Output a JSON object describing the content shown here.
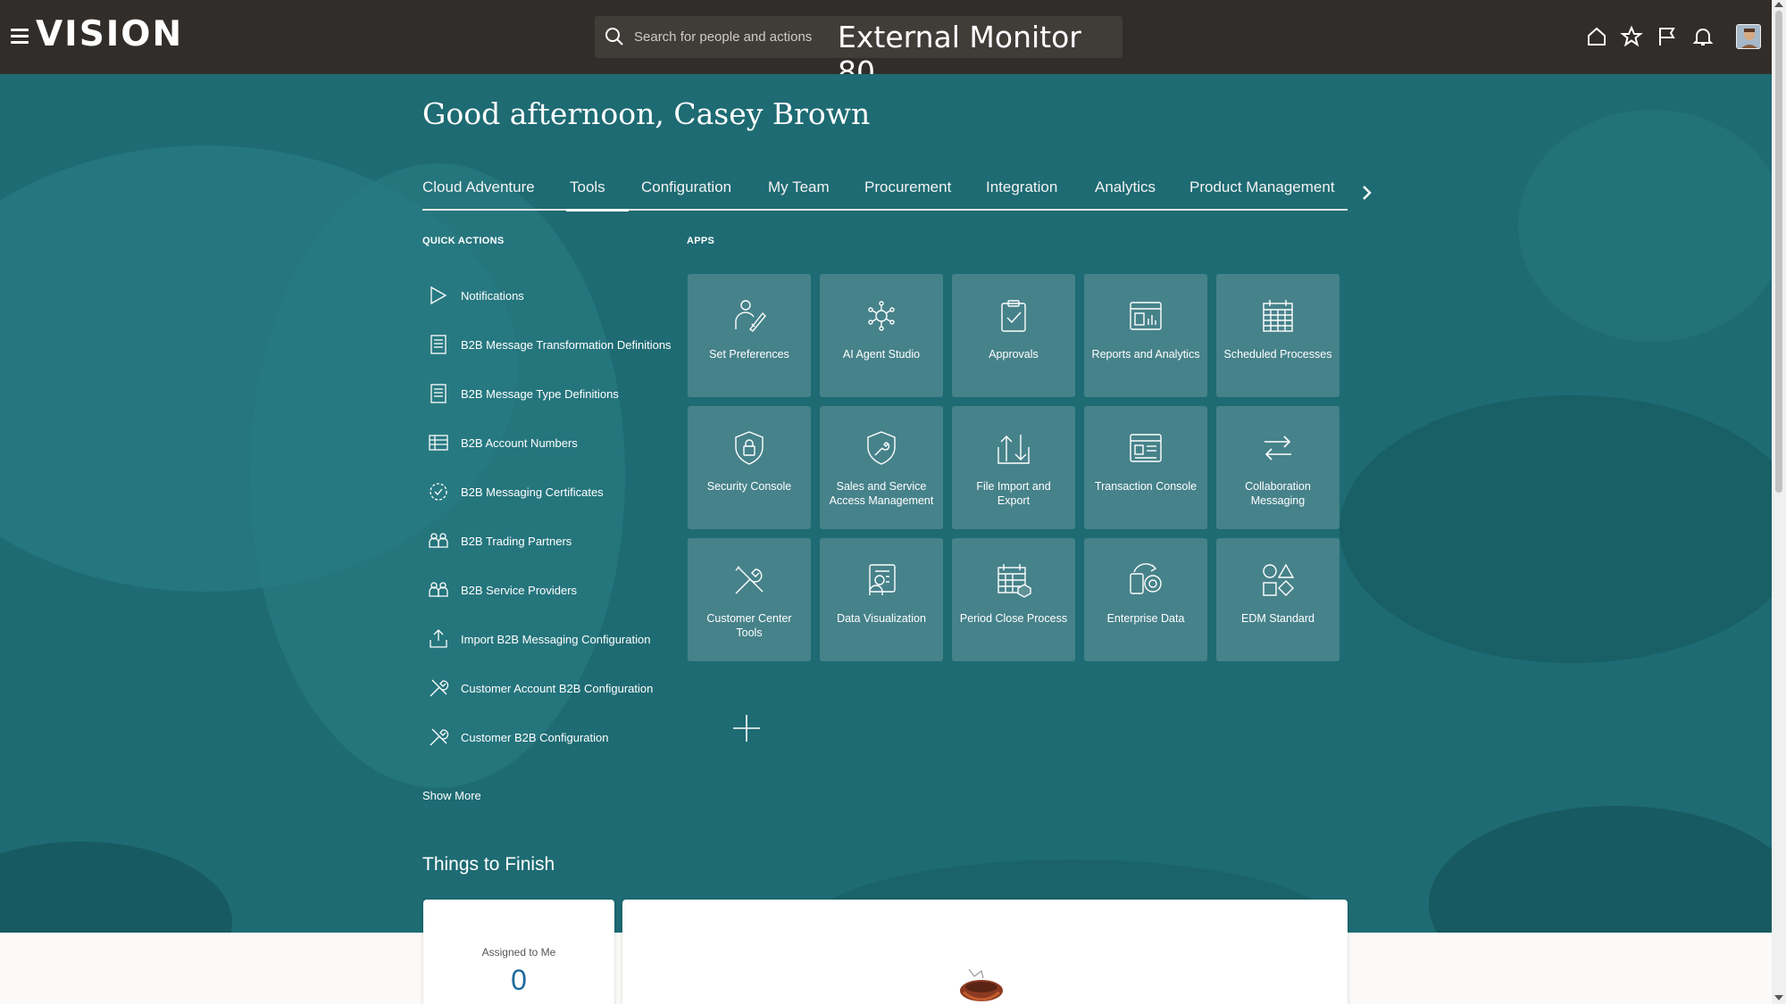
{
  "header": {
    "brand": "VISION",
    "search_placeholder": "Search for people and actions",
    "monitor_label": "External Monitor 80",
    "icons": [
      "home-icon",
      "star-icon",
      "flag-icon",
      "bell-icon",
      "avatar"
    ]
  },
  "greeting": "Good afternoon, Casey Brown",
  "tabs": [
    {
      "label": "Cloud Adventure"
    },
    {
      "label": "Tools",
      "active": true
    },
    {
      "label": "Configuration"
    },
    {
      "label": "My Team"
    },
    {
      "label": "Procurement"
    },
    {
      "label": "Integration"
    },
    {
      "label": "Analytics"
    },
    {
      "label": "Product Management"
    }
  ],
  "quick_actions": {
    "title": "QUICK ACTIONS",
    "items": [
      {
        "label": "Notifications",
        "icon": "notification-icon"
      },
      {
        "label": "B2B Message Transformation Definitions",
        "icon": "document-icon"
      },
      {
        "label": "B2B Message Type Definitions",
        "icon": "document-icon"
      },
      {
        "label": "B2B Account Numbers",
        "icon": "table-icon"
      },
      {
        "label": "B2B Messaging Certificates",
        "icon": "certificate-icon"
      },
      {
        "label": "B2B Trading Partners",
        "icon": "partners-icon"
      },
      {
        "label": "B2B Service Providers",
        "icon": "partners-icon"
      },
      {
        "label": "Import B2B Messaging Configuration",
        "icon": "import-icon"
      },
      {
        "label": "Customer Account B2B Configuration",
        "icon": "tools-icon"
      },
      {
        "label": "Customer B2B Configuration",
        "icon": "tools-icon"
      }
    ],
    "show_more": "Show More"
  },
  "apps": {
    "title": "APPS",
    "tiles": [
      {
        "label": "Set Preferences",
        "icon": "preferences-icon"
      },
      {
        "label": "AI Agent Studio",
        "icon": "ai-agent-icon"
      },
      {
        "label": "Approvals",
        "icon": "clipboard-check-icon"
      },
      {
        "label": "Reports and Analytics",
        "icon": "report-icon"
      },
      {
        "label": "Scheduled Processes",
        "icon": "calendar-grid-icon"
      },
      {
        "label": "Security Console",
        "icon": "shield-lock-icon"
      },
      {
        "label": "Sales and Service Access Management",
        "icon": "shield-wrench-icon"
      },
      {
        "label": "File Import and Export",
        "icon": "import-export-icon"
      },
      {
        "label": "Transaction Console",
        "icon": "console-icon"
      },
      {
        "label": "Collaboration Messaging",
        "icon": "swap-arrows-icon"
      },
      {
        "label": "Customer Center Tools",
        "icon": "tools-icon"
      },
      {
        "label": "Data Visualization",
        "icon": "data-visualization-icon"
      },
      {
        "label": "Period Close Process",
        "icon": "period-close-icon"
      },
      {
        "label": "Enterprise Data",
        "icon": "enterprise-data-icon"
      },
      {
        "label": "EDM Standard",
        "icon": "shapes-icon"
      }
    ]
  },
  "things_to_finish": {
    "title": "Things to Finish",
    "assigned_label": "Assigned to Me",
    "assigned_count": "0"
  }
}
